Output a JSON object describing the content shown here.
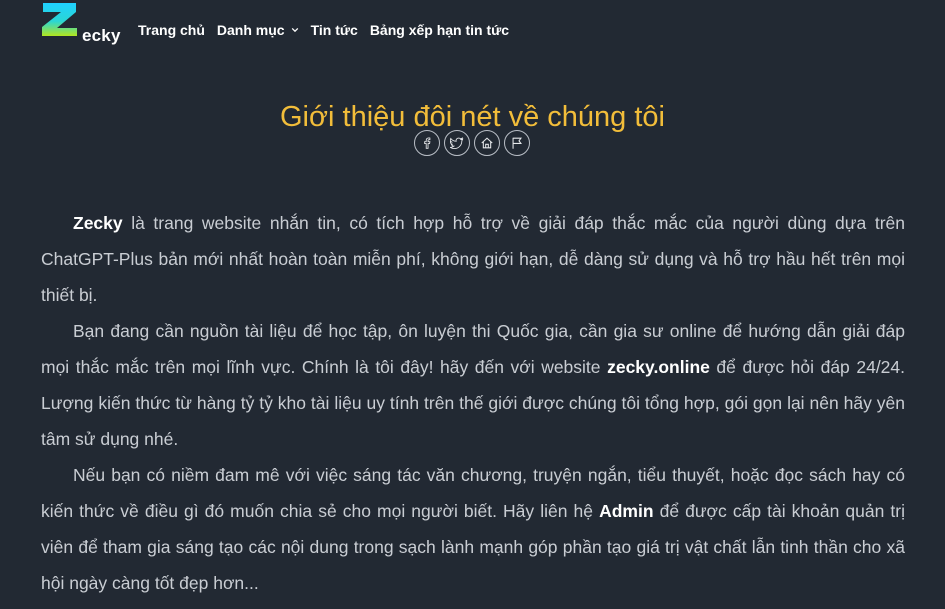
{
  "logo": {
    "text": "ecky"
  },
  "nav": {
    "items": [
      {
        "label": "Trang chủ"
      },
      {
        "label": "Danh mục"
      },
      {
        "label": "Tin tức"
      },
      {
        "label": "Bảng xếp hạn tin tức"
      }
    ]
  },
  "page": {
    "title": "Giới thiệu đôi nét về chúng tôi"
  },
  "share": {
    "buttons": [
      {
        "icon": "facebook-icon"
      },
      {
        "icon": "twitter-icon"
      },
      {
        "icon": "home-icon"
      },
      {
        "icon": "flag-icon"
      }
    ]
  },
  "paragraphs": {
    "p1": {
      "brand": "Zecky",
      "text": " là trang website nhắn tin, có tích hợp hỗ trợ về giải đáp thắc mắc của người dùng dựa trên ChatGPT-Plus bản mới nhất hoàn toàn miễn phí, không giới hạn, dễ dàng sử dụng và hỗ trợ hầu hết trên mọi thiết bị."
    },
    "p2": {
      "text_a": "Bạn đang cần nguồn tài liệu để học tập, ôn luyện thi Quốc gia, cần gia sư online để hướng dẫn giải đáp mọi thắc mắc trên mọi lĩnh vực. Chính là tôi đây! hãy đến với website ",
      "site": "zecky.online",
      "text_b": " để được hỏi đáp 24/24. Lượng kiến thức từ hàng tỷ tỷ kho tài liệu uy tính trên thế giới được chúng tôi tổng hợp, gói gọn lại nên hãy yên tâm sử dụng nhé."
    },
    "p3": {
      "text_a": "Nếu bạn có niềm đam mê với việc sáng tác văn chương, truyện ngắn, tiểu thuyết, hoặc đọc sách hay có kiến thức về điều gì đó muốn chia sẻ cho mọi người biết. Hãy liên hệ ",
      "admin": "Admin",
      "text_b": " để được cấp tài khoản quản trị viên để tham gia sáng tạo các nội dung trong sạch lành mạnh góp phần tạo giá trị vật chất lẫn tinh thần cho xã hội ngày càng tốt đẹp hơn..."
    }
  },
  "colors": {
    "background": "#222933",
    "title": "#f2bd3a",
    "logo_top": "#1fd0ff",
    "logo_bottom": "#b3e61e"
  }
}
